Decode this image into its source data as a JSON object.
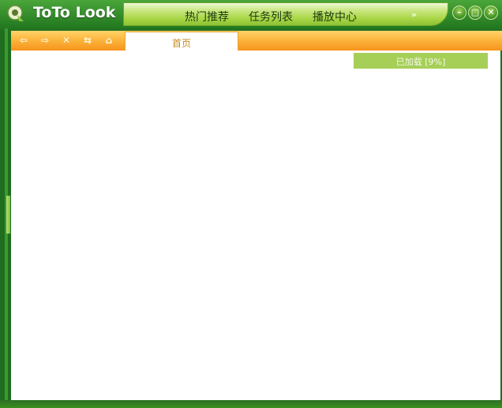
{
  "app": {
    "title": "ToTo Look"
  },
  "nav": {
    "items": [
      {
        "label": "热门推荐"
      },
      {
        "label": "任务列表"
      },
      {
        "label": "播放中心"
      }
    ],
    "more_label": "»"
  },
  "window_controls": {
    "minimize": "–",
    "maximize": "□",
    "close": "✕"
  },
  "toolbar": {
    "icons": [
      {
        "name": "back",
        "glyph": "⇦"
      },
      {
        "name": "forward",
        "glyph": "⇨"
      },
      {
        "name": "stop",
        "glyph": "✕"
      },
      {
        "name": "refresh",
        "glyph": "⇆"
      },
      {
        "name": "home",
        "glyph": "⌂"
      }
    ]
  },
  "tabs": [
    {
      "label": "首页",
      "active": true
    }
  ],
  "loading": {
    "label": "已加载 [9%]",
    "percent": 9
  },
  "colors": {
    "frame_green": "#2a7a2a",
    "nav_green": "#a9d645",
    "toolbar_orange": "#f7931c",
    "progress_green": "#a6cf58"
  }
}
